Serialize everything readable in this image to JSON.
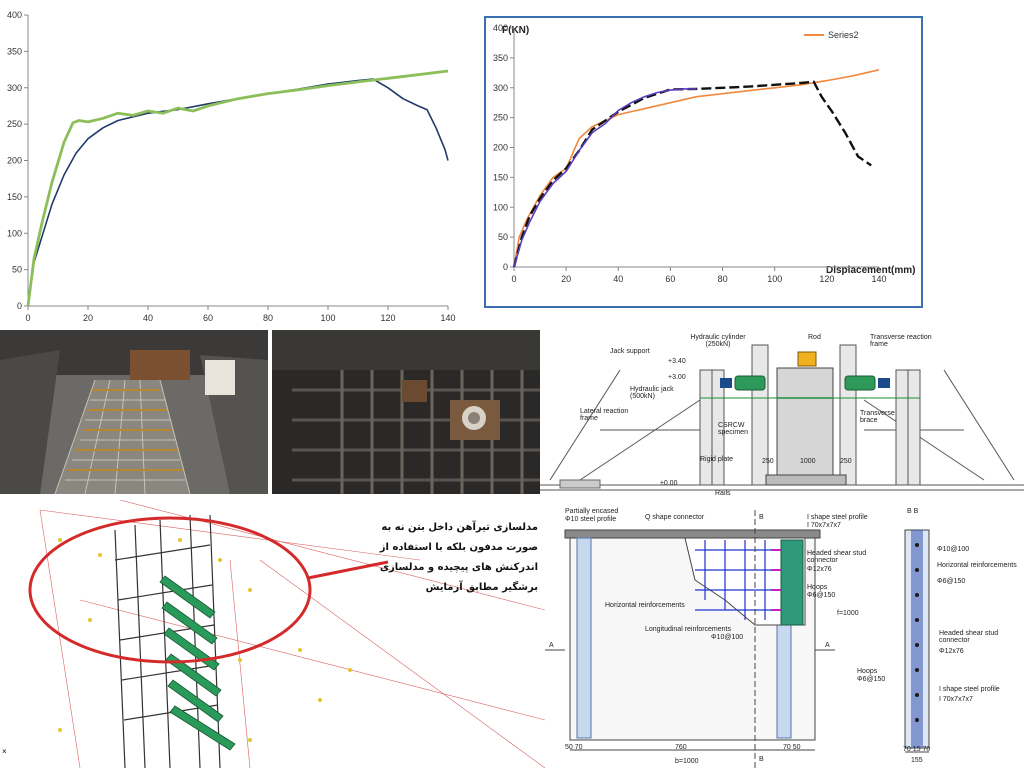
{
  "chart_data": [
    {
      "type": "line",
      "title": "",
      "xlabel": "",
      "ylabel": "",
      "xlim": [
        0,
        140
      ],
      "ylim": [
        0,
        400
      ],
      "x_ticks": [
        "0",
        "20",
        "40",
        "60",
        "80",
        "100",
        "120",
        "140"
      ],
      "y_ticks": [
        "0",
        "50",
        "100",
        "150",
        "200",
        "250",
        "300",
        "350",
        "400"
      ],
      "grid": false,
      "legend": "none",
      "series": [
        {
          "color": "#1f3a6b",
          "x": [
            0,
            2,
            5,
            8,
            12,
            16,
            20,
            25,
            30,
            40,
            50,
            60,
            70,
            80,
            90,
            100,
            110,
            115,
            120,
            125,
            130,
            133,
            136,
            139,
            140
          ],
          "y": [
            0,
            60,
            100,
            140,
            180,
            210,
            230,
            245,
            255,
            265,
            270,
            278,
            285,
            292,
            298,
            305,
            310,
            312,
            300,
            285,
            275,
            270,
            245,
            215,
            200
          ]
        },
        {
          "color": "#8cbf5a",
          "x": [
            0,
            2,
            5,
            8,
            12,
            15,
            17,
            20,
            25,
            30,
            35,
            40,
            45,
            50,
            55,
            60,
            70,
            80,
            90,
            100,
            110,
            120,
            130,
            140
          ],
          "y": [
            0,
            65,
            120,
            170,
            225,
            252,
            255,
            253,
            258,
            265,
            262,
            268,
            265,
            272,
            268,
            275,
            285,
            292,
            297,
            303,
            308,
            313,
            318,
            323
          ]
        }
      ]
    },
    {
      "type": "line",
      "title": "",
      "xlabel": "Displacement(mm)",
      "ylabel": "F(KN)",
      "xlim": [
        0,
        140
      ],
      "ylim": [
        0,
        400
      ],
      "x_ticks": [
        "0",
        "20",
        "40",
        "60",
        "80",
        "100",
        "120",
        "140"
      ],
      "y_ticks": [
        "0",
        "50",
        "100",
        "150",
        "200",
        "250",
        "300",
        "350",
        "400"
      ],
      "grid": false,
      "legend": "top",
      "series": [
        {
          "name": "Series2",
          "color": "#f0883e",
          "x": [
            0,
            2,
            5,
            10,
            15,
            20,
            25,
            30,
            35,
            40,
            50,
            60,
            70,
            80,
            90,
            100,
            110,
            120,
            130,
            140
          ],
          "y": [
            0,
            50,
            80,
            120,
            150,
            165,
            215,
            235,
            245,
            255,
            265,
            275,
            285,
            290,
            295,
            300,
            305,
            312,
            320,
            330
          ]
        },
        {
          "color": "#111111",
          "x": [
            0,
            3,
            6,
            10,
            15,
            20,
            25,
            30,
            40,
            50,
            60,
            70,
            80,
            90,
            100,
            110,
            115,
            118,
            122,
            127,
            132,
            137
          ],
          "y": [
            0,
            50,
            85,
            115,
            145,
            165,
            195,
            230,
            260,
            283,
            297,
            298,
            300,
            302,
            305,
            308,
            310,
            285,
            260,
            225,
            185,
            170
          ]
        },
        {
          "color": "#5a3cc0",
          "x": [
            0,
            3,
            6,
            10,
            15,
            20,
            25,
            30,
            35,
            40,
            45,
            50,
            55,
            60,
            65,
            70
          ],
          "y": [
            0,
            45,
            75,
            110,
            140,
            160,
            195,
            225,
            240,
            262,
            275,
            285,
            292,
            296,
            298,
            298
          ]
        }
      ]
    }
  ],
  "setup_labels": {
    "cylinder": "Hydraulic cylinder (250kN)",
    "rod": "Rod",
    "transverse_frame": "Transverse reaction frame",
    "jack_support": "Jack support",
    "elev_340": "+3.40",
    "elev_300": "+3.00",
    "jack": "Hydraulic jack (500kN)",
    "lateral_frame": "Lateral reaction frame",
    "specimen": "CSRCW specimen",
    "brace": "Transverse brace",
    "rigid_plate": "Rigid plate",
    "dim_1000": "1000",
    "dim_250_left": "250",
    "dim_250_right": "250",
    "elev_000": "±0.00",
    "rails": "Rails"
  },
  "model_note": "مدلسازی تیرآهن داخل بتن نه به صورت مدفون بلکه با استفاده از اندرکنش های پیچیده و مدلسازی برشگیر مطابق آزمایش",
  "section_labels": {
    "partially_encased": "Partially encased",
    "steel_profile": "Φ10 steel profile",
    "q_connector": "Q shape connector",
    "i_profile": "I shape steel profile",
    "i_profile_size": "I 70x7x7x7",
    "headed_stud": "Headed shear stud connector",
    "stud_size": "Φ12x76",
    "hoops": "Hoops",
    "hoops_size": "Φ6@150",
    "horizontal_reinf": "Horizontal reinforcements",
    "longitudinal_reinf": "Longitudinal reinforcements",
    "long_size": "Φ10@100",
    "section_a": "A",
    "section_b": "B",
    "dim_50_70": "50 70",
    "dim_760": "760",
    "dim_70_50": "70 50",
    "dim_b": "b=1000",
    "height": "f=1000",
    "bb_title": "B B",
    "bb_long": "Φ10@100",
    "bb_horizontal": "Horizontal reinforcements",
    "bb_hz_size": "Φ6@150",
    "bb_stud": "Headed shear stud connector",
    "bb_stud_size": "Φ12x76",
    "bb_hoops": "Hoops",
    "bb_hoops_size": "Φ6@150",
    "bb_i_profile": "I shape steel profile",
    "bb_i_size": "I 70x7x7x7",
    "bb_dims": "70 15 70",
    "bb_total": "155"
  },
  "model_axis_glyph": "×"
}
